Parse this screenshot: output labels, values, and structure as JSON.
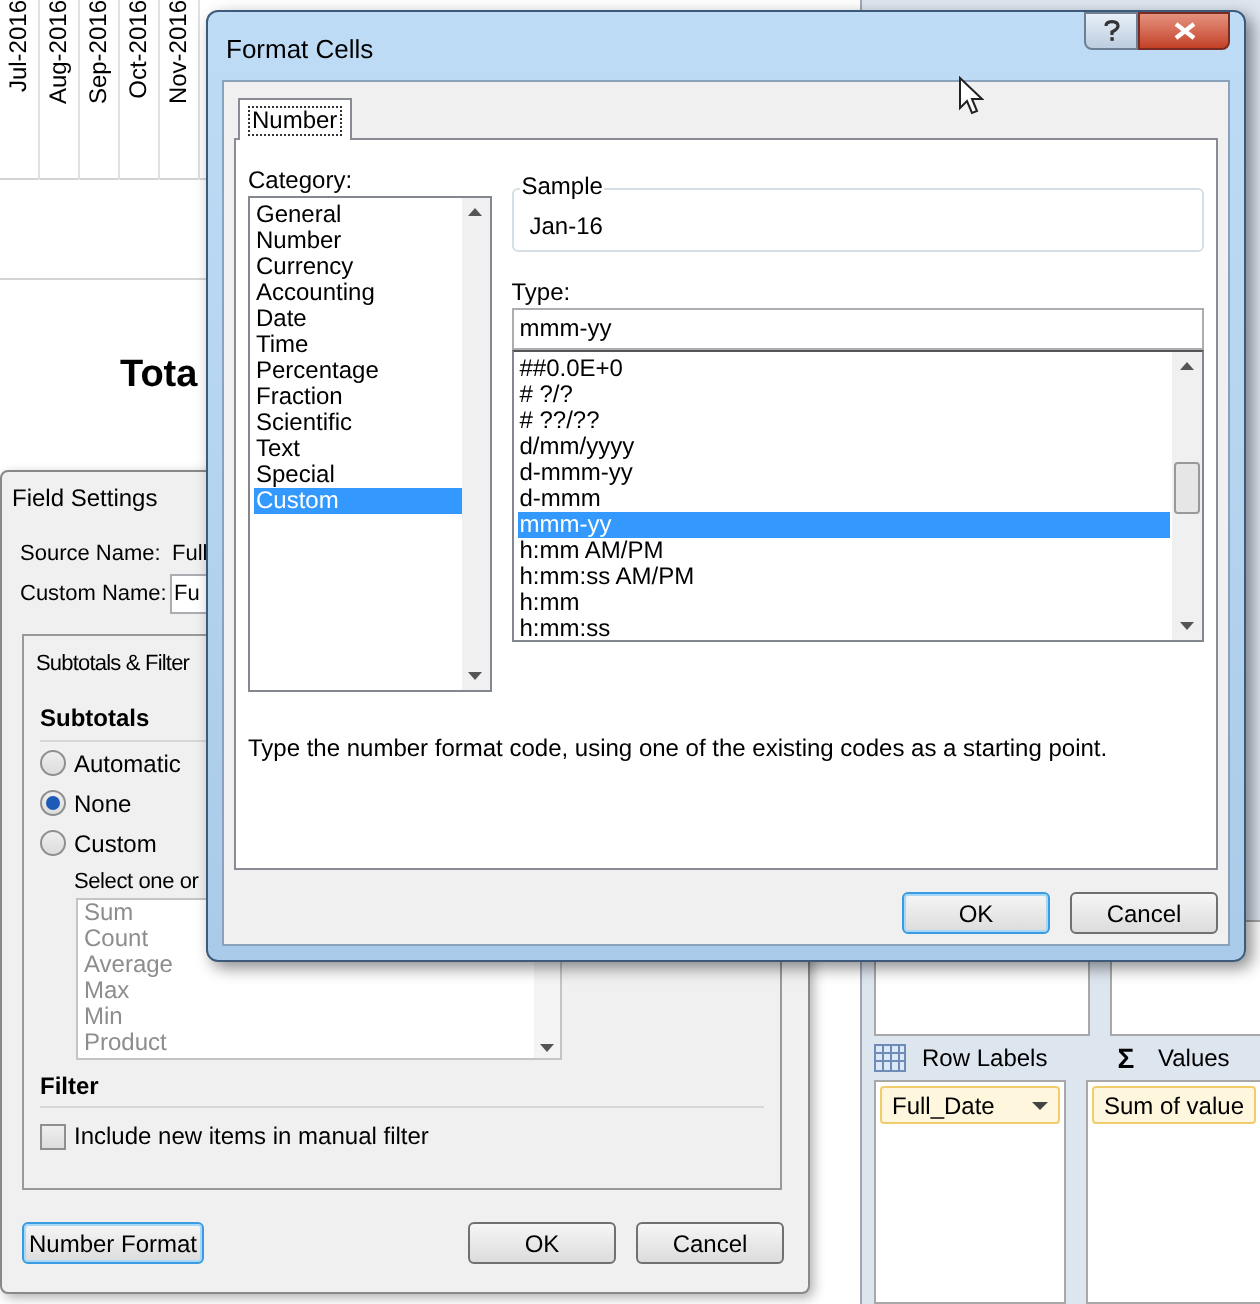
{
  "spreadsheet": {
    "date_headers": [
      "Jul-2016",
      "Aug-2016",
      "Sep-2016",
      "Oct-2016",
      "Nov-2016"
    ],
    "total_label": "Tota"
  },
  "pivot_pane": {
    "areas": [
      {
        "kind": "rows",
        "label": "Row Labels",
        "field": "Full_Date"
      },
      {
        "kind": "values",
        "label": "Values",
        "symbol": "Σ",
        "field": "Sum of value"
      }
    ]
  },
  "field_settings": {
    "title": "Field Settings",
    "source_name": {
      "label": "Source Name:",
      "value": "Full"
    },
    "custom_name": {
      "label": "Custom Name:",
      "value": "Fu"
    },
    "tabs": [
      {
        "label": "Subtotals & Filter",
        "selected": true
      }
    ],
    "subtotals": {
      "heading": "Subtotals",
      "options": [
        {
          "label": "Automatic",
          "selected": false
        },
        {
          "label": "None",
          "selected": true
        },
        {
          "label": "Custom",
          "selected": false
        }
      ],
      "hint": "Select one or",
      "functions": {
        "disabled": true,
        "items": [
          "Sum",
          "Count",
          "Average",
          "Max",
          "Min",
          "Product"
        ]
      }
    },
    "filter": {
      "heading": "Filter",
      "include_new_items": {
        "label": "Include new items in manual filter",
        "checked": false
      }
    },
    "buttons": [
      {
        "label": "Number Format",
        "focused": true
      },
      {
        "label": "OK",
        "focused": false
      },
      {
        "label": "Cancel",
        "focused": false
      }
    ]
  },
  "format_cells": {
    "title": "Format Cells",
    "tabs": [
      {
        "label": "Number",
        "selected": true
      }
    ],
    "category": {
      "label": "Category:",
      "items": [
        {
          "label": "General",
          "selected": false
        },
        {
          "label": "Number",
          "selected": false
        },
        {
          "label": "Currency",
          "selected": false
        },
        {
          "label": "Accounting",
          "selected": false
        },
        {
          "label": "Date",
          "selected": false
        },
        {
          "label": "Time",
          "selected": false
        },
        {
          "label": "Percentage",
          "selected": false
        },
        {
          "label": "Fraction",
          "selected": false
        },
        {
          "label": "Scientific",
          "selected": false
        },
        {
          "label": "Text",
          "selected": false
        },
        {
          "label": "Special",
          "selected": false
        },
        {
          "label": "Custom",
          "selected": true
        }
      ]
    },
    "sample": {
      "label": "Sample",
      "value": "Jan-16"
    },
    "type": {
      "label": "Type:",
      "value": "mmm-yy",
      "items": [
        {
          "label": "##0.0E+0",
          "selected": false
        },
        {
          "label": "# ?/?",
          "selected": false
        },
        {
          "label": "# ??/??",
          "selected": false
        },
        {
          "label": "d/mm/yyyy",
          "selected": false
        },
        {
          "label": "d-mmm-yy",
          "selected": false
        },
        {
          "label": "d-mmm",
          "selected": false
        },
        {
          "label": "mmm-yy",
          "selected": true
        },
        {
          "label": "h:mm AM/PM",
          "selected": false
        },
        {
          "label": "h:mm:ss AM/PM",
          "selected": false
        },
        {
          "label": "h:mm",
          "selected": false
        },
        {
          "label": "h:mm:ss",
          "selected": false
        }
      ]
    },
    "description": "Type the number format code, using one of the existing codes as a starting point.",
    "buttons": [
      {
        "label": "OK",
        "focused": true
      },
      {
        "label": "Cancel",
        "focused": false
      }
    ]
  }
}
